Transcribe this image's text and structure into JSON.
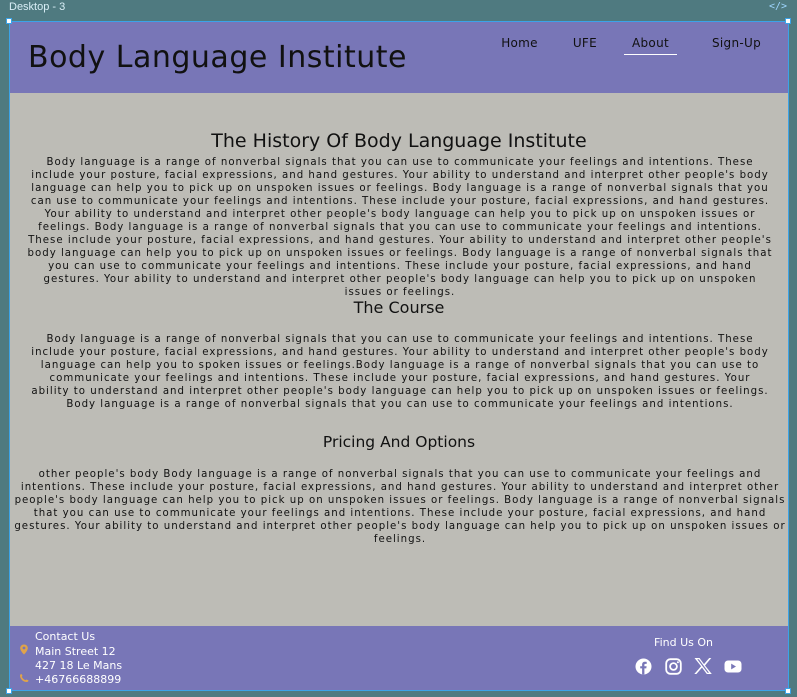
{
  "editor": {
    "frame_label": "Desktop - 3",
    "code_icon": "code-icon"
  },
  "header": {
    "title": "Body Language Institute",
    "nav": [
      {
        "label": "Home"
      },
      {
        "label": "UFE"
      },
      {
        "label": "About",
        "active": true
      },
      {
        "label": "Sign-Up"
      }
    ]
  },
  "main": {
    "history": {
      "heading": "The History Of Body Language Institute",
      "text": "Body language is a range of nonverbal signals that you can use to communicate your feelings and intentions. These include your posture, facial expressions, and hand gestures. Your ability to understand and interpret other people's body language can help you to pick up on unspoken issues or feelings. Body language is a range of nonverbal signals that you can use to communicate your feelings and intentions. These include your posture, facial expressions, and hand gestures. Your ability to understand and interpret other people's body language can help you to pick up on unspoken issues or feelings. Body language is a range of nonverbal signals that you can use to communicate your feelings and intentions. These include your posture, facial expressions, and hand gestures. Your ability to understand and interpret other people's body language can help you to pick up on unspoken issues or feelings. Body language is a range of nonverbal signals that you can use to communicate your feelings and intentions. These include your posture, facial expressions, and hand gestures. Your ability to understand and interpret other people's body language can help you to pick up on unspoken issues or feelings."
    },
    "course": {
      "heading": "The Course",
      "text": "Body language is a range of nonverbal signals that you can use to communicate your feelings and intentions. These include your posture, facial expressions, and hand gestures. Your ability to understand and interpret other people's body language can help you to spoken issues or feelings.Body language is a range of nonverbal signals that you can use to communicate your feelings and intentions. These include your posture, facial expressions, and hand gestures. Your ability to understand and interpret other people's body language can help you to pick up on unspoken issues or feelings. Body language is a range of nonverbal signals that you can use to communicate your feelings and intentions."
    },
    "pricing": {
      "heading": "Pricing And Options",
      "text": "other people's body Body language is a range of nonverbal signals that you can use to communicate your feelings and intentions. These include your posture, facial expressions, and hand gestures. Your ability to understand and interpret other people's body language can help you to pick up on unspoken issues or feelings. Body language is a range of nonverbal signals that you can use to communicate your feelings and intentions. These include your posture, facial expressions, and hand gestures. Your ability to understand and interpret other people's body language can help you to pick up on unspoken issues or feelings."
    }
  },
  "footer": {
    "contact_title": "Contact Us",
    "address_line1": "Main Street  12",
    "address_line2": "427 18 Le Mans",
    "phone": "+46766688899",
    "find_us": "Find Us On",
    "social": [
      "facebook-icon",
      "instagram-icon",
      "x-icon",
      "youtube-icon"
    ]
  },
  "colors": {
    "header_bg": "#7876b7",
    "body_bg": "#bdbcb6",
    "accent_icon": "#e0a34a"
  }
}
